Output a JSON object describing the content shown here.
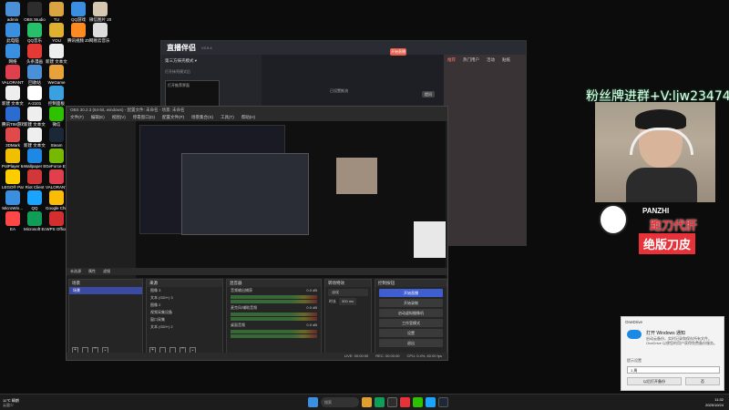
{
  "overlay": {
    "promo": "粉丝牌进群+V:ljw2347464"
  },
  "badge": {
    "name": "PANZHI",
    "line1": "跑刀代肝",
    "line2": "绝版刀皮"
  },
  "desktop_icons": [
    {
      "label": "admin",
      "color": "#4a90d9"
    },
    {
      "label": "OBS Studio",
      "color": "#2d2d2d"
    },
    {
      "label": "TU",
      "color": "#d9a441"
    },
    {
      "label": "QQ游戏",
      "color": "#3a8fe0"
    },
    {
      "label": "微信图片 2025102…",
      "color": "#d6c8b0"
    },
    {
      "label": "此电脑",
      "color": "#3a8fe0"
    },
    {
      "label": "QQ音乐",
      "color": "#27c06a"
    },
    {
      "label": "YOU",
      "color": "#e0b030"
    },
    {
      "label": "腾讯视频 ZS",
      "color": "#ff8a1f"
    },
    {
      "label": "网易云音乐 会员体验",
      "color": "#ddd"
    },
    {
      "label": "网络",
      "color": "#3a8fe0"
    },
    {
      "label": "头条漫画",
      "color": "#e53935"
    },
    {
      "label": "新建 文本文档 (3)",
      "color": "#eee"
    },
    {
      "label": "VALORANT Influence…",
      "color": "#e0404e"
    },
    {
      "label": "回收站",
      "color": "#4a90d9"
    },
    {
      "label": "WeGame",
      "color": "#e8a23a"
    },
    {
      "label": "新建 文本文档 (5)",
      "color": "#eee"
    },
    {
      "label": "A-2101",
      "color": "#fff"
    },
    {
      "label": "控制面板",
      "color": "#3aa0e0"
    },
    {
      "label": "腾讯TIM游戏",
      "color": "#2a6cd0"
    },
    {
      "label": "新建 文本文档 (6)",
      "color": "#eee"
    },
    {
      "label": "微信",
      "color": "#2dc100"
    },
    {
      "label": "3DMark",
      "color": "#e04a4a"
    },
    {
      "label": "新建 文本文档 (7)",
      "color": "#eee"
    },
    {
      "label": "Steam",
      "color": "#1b2838"
    },
    {
      "label": "PotPlayer 64 bit",
      "color": "#f0c000"
    },
    {
      "label": "Wallpaper Engine:…",
      "color": "#1e88e5"
    },
    {
      "label": "GeForce Experience",
      "color": "#76b900"
    },
    {
      "label": "LEGO® Party!",
      "color": "#ffcc00"
    },
    {
      "label": "Riot Client",
      "color": "#d13639"
    },
    {
      "label": "VALORANT",
      "color": "#e0404e"
    },
    {
      "label": "MicroWin…",
      "color": "#3a8fe0"
    },
    {
      "label": "QQ",
      "color": "#1aa3ff"
    },
    {
      "label": "Google Chrome",
      "color": "#fbbc05"
    },
    {
      "label": "EA",
      "color": "#ff4747"
    },
    {
      "label": "Microsoft Edge",
      "color": "#0f9d58"
    },
    {
      "label": "WPS Office",
      "color": "#d32f2f"
    }
  ],
  "live_window": {
    "logo": "直播伴侣",
    "version": "V3.9.4",
    "channel": "第三方抹壳模式 ▾",
    "start_label": "开始直播",
    "tabs": [
      "推荐",
      "热门用户",
      "活动",
      "贴纸"
    ],
    "side_title": "打开抹壳模式后",
    "scene_label": "打开推荐界面",
    "preview_hint": "已设置推流",
    "ask_label": "提问"
  },
  "obs": {
    "title": "OBS 30.2.3 (64-bit, windows) - 配置文件: 未命名 - 场景: 未命名",
    "menu": [
      "文件(F)",
      "编辑(E)",
      "视图(V)",
      "停靠窗口(D)",
      "配置文件(P)",
      "场景集合(S)",
      "工具(T)",
      "帮助(H)"
    ],
    "scenebar": [
      "未选源",
      "属性",
      "滤镜"
    ],
    "docks": {
      "scenes": {
        "title": "场景",
        "items": [
          "场景"
        ]
      },
      "sources": {
        "title": "来源",
        "items": [
          "图像 3",
          "文本 (GDI+) 3",
          "图像 2",
          "视频采集设备",
          "窗口采集",
          "文本 (GDI+) 2"
        ]
      },
      "mixer": {
        "title": "混音器",
        "channels": [
          {
            "name": "音频输出捕获",
            "db": "0.0 dB"
          },
          {
            "name": "麦克风/辅助音频",
            "db": "0.0 dB"
          },
          {
            "name": "桌面音频",
            "db": "0.0 dB"
          }
        ]
      },
      "transitions": {
        "title": "转场特效",
        "type": "淡化",
        "duration_label": "时长",
        "duration": "300 ms"
      },
      "controls": {
        "title": "控制按钮",
        "buttons": [
          "开始直播",
          "开始录制",
          "启动虚拟摄像机",
          "工作室模式",
          "设置",
          "退出"
        ]
      }
    },
    "status": {
      "live": "LIVE: 00:00:00",
      "rec": "REC: 00:00:00",
      "cpu": "CPU: 0.4%, 60.00 fps"
    }
  },
  "toast": {
    "app": "OneDrive",
    "heading": "打开 Windows 通知",
    "body": "启动云备份，实时记录和保存所有文件。OneDrive 以便您的用户获得免费备份服务。",
    "option_label": "提示设置",
    "option": "1 周",
    "btn_primary": "以后打开备份",
    "btn_secondary": "否"
  },
  "taskbar": {
    "weather_title": "11℃ 晴朗",
    "weather_sub": "云量少",
    "search": "搜索",
    "time": "11:32",
    "date": "2025/10/24"
  }
}
